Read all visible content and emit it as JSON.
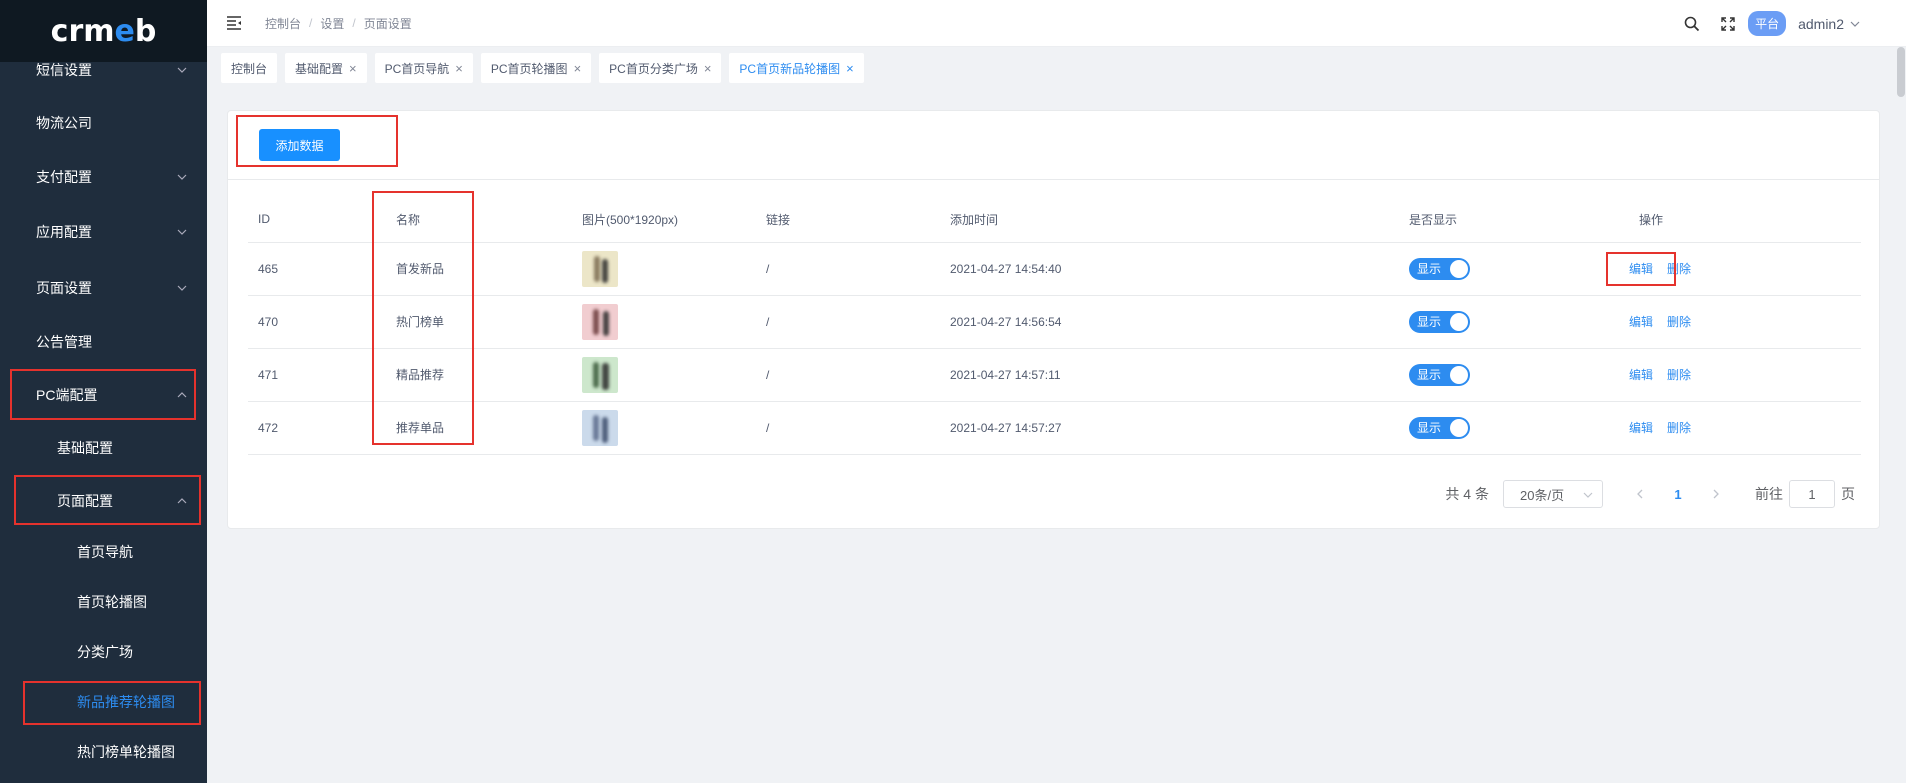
{
  "sidebar": {
    "logo": {
      "part1": "crm",
      "part2": "e",
      "part3": "b"
    },
    "items": [
      {
        "label": "短信设置"
      },
      {
        "label": "物流公司"
      },
      {
        "label": "支付配置"
      },
      {
        "label": "应用配置"
      },
      {
        "label": "页面设置"
      },
      {
        "label": "公告管理"
      },
      {
        "label": "PC端配置"
      },
      {
        "label": "基础配置"
      },
      {
        "label": "页面配置"
      },
      {
        "label": "首页导航"
      },
      {
        "label": "首页轮播图"
      },
      {
        "label": "分类广场"
      },
      {
        "label": "新品推荐轮播图"
      },
      {
        "label": "热门榜单轮播图"
      }
    ]
  },
  "header": {
    "breadcrumb": [
      "控制台",
      "设置",
      "页面设置"
    ],
    "separator": "/",
    "platform_badge": "平台",
    "username": "admin2"
  },
  "tabs": [
    {
      "label": "控制台"
    },
    {
      "label": "基础配置"
    },
    {
      "label": "PC首页导航"
    },
    {
      "label": "PC首页轮播图"
    },
    {
      "label": "PC首页分类广场"
    },
    {
      "label": "PC首页新品轮播图"
    }
  ],
  "toolbar": {
    "add_label": "添加数据"
  },
  "table": {
    "headers": [
      "ID",
      "名称",
      "图片(500*1920px)",
      "链接",
      "添加时间",
      "是否显示",
      "操作"
    ],
    "rows": [
      {
        "id": "465",
        "name": "首发新品",
        "link": "/",
        "time": "2021-04-27 14:54:40",
        "show": "显示",
        "edit": "编辑",
        "del": "删除",
        "thumb_color": "#ece6c8"
      },
      {
        "id": "470",
        "name": "热门榜单",
        "link": "/",
        "time": "2021-04-27 14:56:54",
        "show": "显示",
        "edit": "编辑",
        "del": "删除",
        "thumb_color": "#f1cdd0"
      },
      {
        "id": "471",
        "name": "精品推荐",
        "link": "/",
        "time": "2021-04-27 14:57:11",
        "show": "显示",
        "edit": "编辑",
        "del": "删除",
        "thumb_color": "#cde7cc"
      },
      {
        "id": "472",
        "name": "推荐单品",
        "link": "/",
        "time": "2021-04-27 14:57:27",
        "show": "显示",
        "edit": "编辑",
        "del": "删除",
        "thumb_color": "#cbdaeb"
      }
    ]
  },
  "pagination": {
    "total": "共 4 条",
    "page_size": "20条/页",
    "current": "1",
    "goto_prefix": "前往",
    "goto_value": "1",
    "goto_suffix": "页"
  },
  "colors": {
    "accent": "#2d8cf0",
    "highlight": "#e5322d",
    "sidebar_bg": "#1f2d3d"
  }
}
